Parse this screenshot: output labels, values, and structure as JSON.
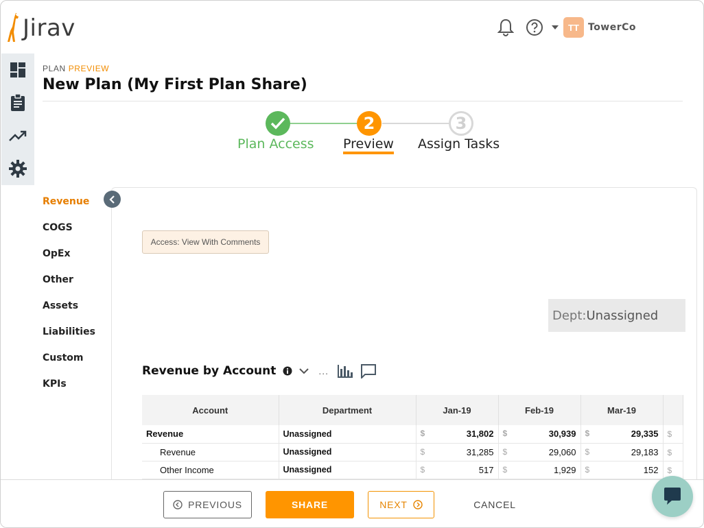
{
  "app": {
    "name": "Jirav"
  },
  "header": {
    "company": "TowerCo",
    "avatar_initials": "TT"
  },
  "breadcrumb": {
    "prefix": "PLAN",
    "current": "PREVIEW"
  },
  "page_title": "New Plan (My First Plan Share)",
  "stepper": {
    "steps": [
      {
        "label": "Plan Access",
        "state": "done"
      },
      {
        "number": "2",
        "label": "Preview",
        "state": "current"
      },
      {
        "number": "3",
        "label": "Assign Tasks",
        "state": "todo"
      }
    ]
  },
  "categories": [
    "Revenue",
    "COGS",
    "OpEx",
    "Other",
    "Assets",
    "Liabilities",
    "Custom",
    "KPIs"
  ],
  "active_category": "Revenue",
  "access_badge": "Access: View With Comments",
  "dept_filter": {
    "label": "Dept:",
    "value": "Unassigned"
  },
  "report": {
    "title": "Revenue by Account",
    "more": "..."
  },
  "table": {
    "columns": [
      "Account",
      "Department",
      "Jan-19",
      "Feb-19",
      "Mar-19"
    ],
    "currency_symbol": "$",
    "rows": [
      {
        "account": "Revenue",
        "department": "Unassigned",
        "values": [
          "31,802",
          "30,939",
          "29,335"
        ]
      },
      {
        "account": "Revenue",
        "department": "Unassigned",
        "values": [
          "31,285",
          "29,060",
          "29,183"
        ]
      },
      {
        "account": "Other Income",
        "department": "Unassigned",
        "values": [
          "517",
          "1,929",
          "152"
        ]
      }
    ]
  },
  "footer": {
    "previous": "PREVIOUS",
    "share": "SHARE",
    "next": "NEXT",
    "cancel": "CANCEL"
  },
  "colors": {
    "accent": "#ff9500",
    "success": "#5cb85c",
    "inactive": "#d8d8d8",
    "sidebar": "#e8ecef"
  }
}
